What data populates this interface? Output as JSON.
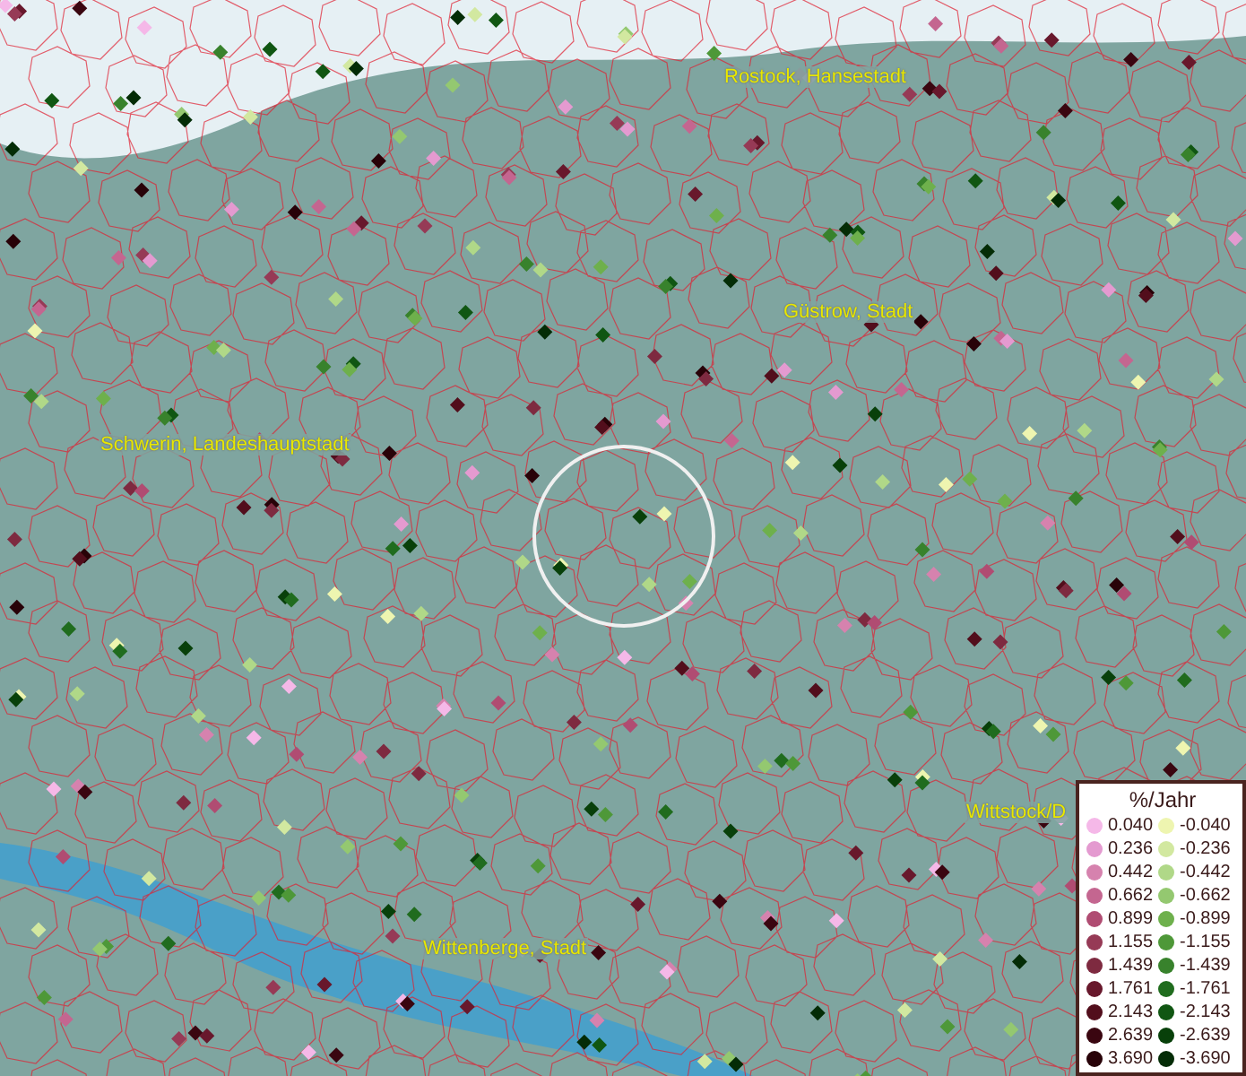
{
  "map": {
    "places": [
      {
        "name": "Rostock, Hansestadt"
      },
      {
        "name": "Güstrow, Stadt"
      },
      {
        "name": "Schwerin, Landeshauptstadt"
      },
      {
        "name": "Wittstock/D"
      },
      {
        "name": "Wittenberge, Stadt"
      }
    ]
  },
  "legend": {
    "title": "%/Jahr",
    "entries": [
      {
        "label": "0.040",
        "color": "#f5b8e8"
      },
      {
        "label": "-0.040",
        "color": "#eef5b0"
      },
      {
        "label": "0.236",
        "color": "#e49ad0"
      },
      {
        "label": "-0.236",
        "color": "#d2e8a0"
      },
      {
        "label": "0.442",
        "color": "#d682ae"
      },
      {
        "label": "-0.442",
        "color": "#b0d888"
      },
      {
        "label": "0.662",
        "color": "#c46690"
      },
      {
        "label": "-0.662",
        "color": "#94c870"
      },
      {
        "label": "0.899",
        "color": "#b04c72"
      },
      {
        "label": "-0.899",
        "color": "#6eb04c"
      },
      {
        "label": "1.155",
        "color": "#963a56"
      },
      {
        "label": "-1.155",
        "color": "#4e9838"
      },
      {
        "label": "1.439",
        "color": "#7e2a40"
      },
      {
        "label": "-1.439",
        "color": "#38822c"
      },
      {
        "label": "1.761",
        "color": "#68182c"
      },
      {
        "label": "-1.761",
        "color": "#206c1e"
      },
      {
        "label": "2.143",
        "color": "#520e1c"
      },
      {
        "label": "-2.143",
        "color": "#105612"
      },
      {
        "label": "2.639",
        "color": "#3a0610"
      },
      {
        "label": "-2.639",
        "color": "#08400a"
      },
      {
        "label": "3.690",
        "color": "#280208"
      },
      {
        "label": "-3.690",
        "color": "#042c06"
      }
    ]
  }
}
